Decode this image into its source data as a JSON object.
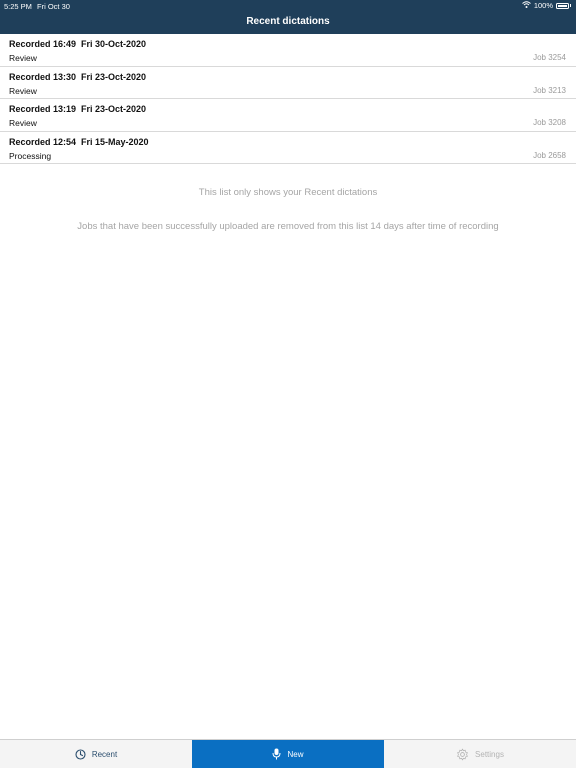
{
  "status_bar": {
    "time": "5:25 PM",
    "date": "Fri Oct 30",
    "battery": "100%"
  },
  "header": {
    "title": "Recent dictations"
  },
  "dictations": [
    {
      "title": "Recorded 16:49  Fri 30-Oct-2020",
      "status": "Review",
      "job": "Job 3254"
    },
    {
      "title": "Recorded 13:30  Fri 23-Oct-2020",
      "status": "Review",
      "job": "Job 3213"
    },
    {
      "title": "Recorded 13:19  Fri 23-Oct-2020",
      "status": "Review",
      "job": "Job 3208"
    },
    {
      "title": "Recorded 12:54  Fri 15-May-2020",
      "status": "Processing",
      "job": "Job 2658"
    }
  ],
  "info": {
    "line1": "This list only shows your Recent dictations",
    "line2": "Jobs that have been successfully uploaded are removed from this list 14 days after time of recording"
  },
  "tabs": {
    "recent": {
      "label": "Recent",
      "icon": "clock-icon"
    },
    "new": {
      "label": "New",
      "icon": "microphone-icon"
    },
    "settings": {
      "label": "Settings",
      "icon": "gear-icon"
    }
  },
  "colors": {
    "header_bg": "#1f3f5a",
    "active_tab_bg": "#0a6fc2"
  }
}
